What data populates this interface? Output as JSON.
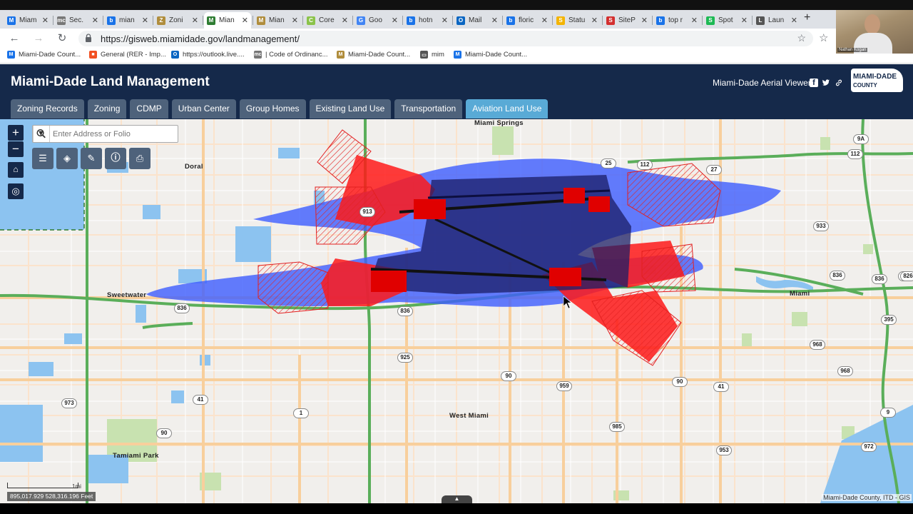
{
  "browser": {
    "tabs": [
      {
        "label": "Miam",
        "color": "#1a73e8",
        "glyph": "M"
      },
      {
        "label": "Sec.",
        "color": "#777777",
        "glyph": "mc"
      },
      {
        "label": "mian",
        "color": "#1a73e8",
        "glyph": "b"
      },
      {
        "label": "Zoni",
        "color": "#b08d3c",
        "glyph": "Z"
      },
      {
        "label": "Mian",
        "color": "#2e7d32",
        "glyph": "M",
        "active": true
      },
      {
        "label": "Mian",
        "color": "#b08d3c",
        "glyph": "M"
      },
      {
        "label": "Core",
        "color": "#8bc34a",
        "glyph": "C"
      },
      {
        "label": "Goo",
        "color": "#4285f4",
        "glyph": "G"
      },
      {
        "label": "hotn",
        "color": "#1a73e8",
        "glyph": "b"
      },
      {
        "label": "Mail",
        "color": "#0a66c2",
        "glyph": "O"
      },
      {
        "label": "floric",
        "color": "#1a73e8",
        "glyph": "b"
      },
      {
        "label": "Statu",
        "color": "#f4b400",
        "glyph": "S"
      },
      {
        "label": "SiteP",
        "color": "#d32f2f",
        "glyph": "S"
      },
      {
        "label": "top r",
        "color": "#1a73e8",
        "glyph": "b"
      },
      {
        "label": "Spot",
        "color": "#1db954",
        "glyph": "S"
      },
      {
        "label": "Laun",
        "color": "#555555",
        "glyph": "L"
      }
    ],
    "url": "https://gisweb.miamidade.gov/landmanagement/",
    "bookmarks": [
      {
        "label": "Miami-Dade Count...",
        "color": "#1a73e8",
        "glyph": "M"
      },
      {
        "label": "General (RER - Imp...",
        "color": "#f25022",
        "glyph": "■"
      },
      {
        "label": "https://outlook.live....",
        "color": "#0a66c2",
        "glyph": "O"
      },
      {
        "label": "| Code of Ordinanc...",
        "color": "#777777",
        "glyph": "mc"
      },
      {
        "label": "Miami-Dade Count...",
        "color": "#b08d3c",
        "glyph": "M"
      },
      {
        "label": "mim",
        "color": "#555555",
        "glyph": "▭"
      },
      {
        "label": "Miami-Dade Count...",
        "color": "#1a73e8",
        "glyph": "M"
      }
    ],
    "webcam_caption": "Nathan Kogan"
  },
  "app": {
    "title": "Miami-Dade Land Management",
    "aerial_link": "Miami-Dade Aerial Viewer",
    "logo_line1": "MIAMI-DADE",
    "logo_line2": "COUNTY",
    "nav_tabs": [
      {
        "label": "Zoning Records"
      },
      {
        "label": "Zoning"
      },
      {
        "label": "CDMP"
      },
      {
        "label": "Urban Center"
      },
      {
        "label": "Group Homes"
      },
      {
        "label": "Existing Land Use"
      },
      {
        "label": "Transportation"
      },
      {
        "label": "Aviation Land Use",
        "active": true
      }
    ],
    "active_tab": "Aviation Land Use"
  },
  "map": {
    "search_placeholder": "Enter Address or Folio",
    "zoom_in": "+",
    "zoom_out": "−",
    "scale_label": "1mi",
    "coordinates": "895,017.929 528,316.196 Feet",
    "attribution": "Miami-Dade County, ITD - GIS",
    "place_labels": [
      "Miami Springs",
      "Doral",
      "Sweetwater",
      "Miami",
      "West Miami",
      "Tamiami Park"
    ],
    "route_shields": [
      "9A",
      "112",
      "25",
      "112",
      "27",
      "933",
      "836",
      "836",
      "836",
      "836",
      "95",
      "395",
      "925",
      "968",
      "968",
      "90",
      "959",
      "90",
      "41",
      "41",
      "9",
      "1",
      "973",
      "90",
      "985",
      "953",
      "972",
      "913",
      "826"
    ],
    "colors": {
      "header": "#15294a",
      "active_tab": "#59aad6",
      "tab": "#4e627b",
      "zone_blue": "#3d5cff",
      "zone_red": "#ff1a1a",
      "zone_dark": "#1b1d66"
    }
  }
}
